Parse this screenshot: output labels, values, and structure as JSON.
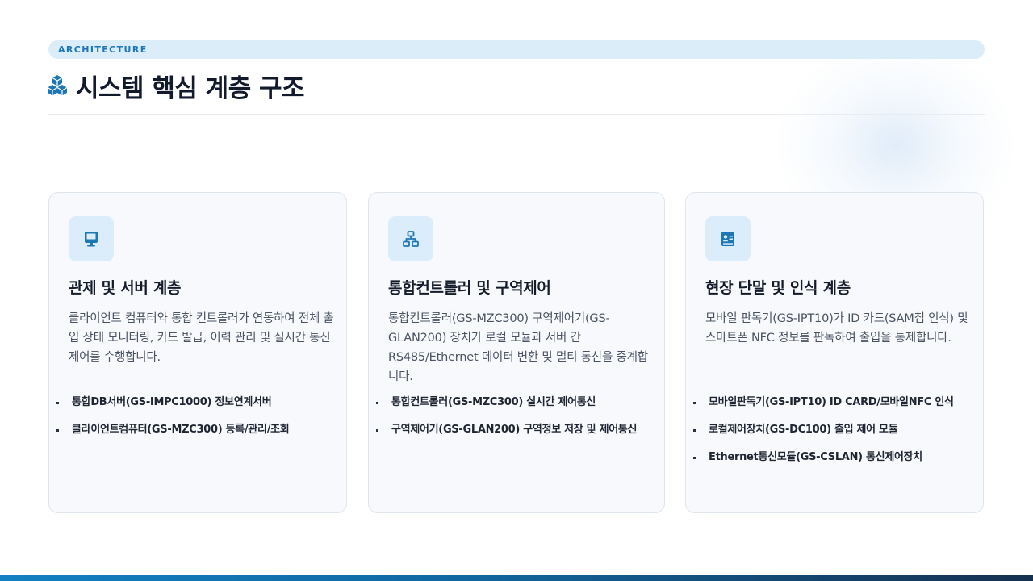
{
  "header": {
    "eyebrow": "ARCHITECTURE",
    "title": "시스템 핵심 계층 구조",
    "title_icon": "cubes-icon"
  },
  "colors": {
    "accent": "#1d77b4",
    "icon_bg": "#dbedfb",
    "card_bg": "#f7f9fc",
    "bottom_bar": [
      "#1280c2",
      "#16304f"
    ]
  },
  "cards": [
    {
      "icon": "desktop-icon",
      "title": "관제 및 서버 계층",
      "desc": "클라이언트 컴퓨터와 통합 컨트롤러가 연동하여 전체 출입 상태 모니터링, 카드 발급, 이력 관리 및 실시간 통신 제어를 수행합니다.",
      "bullets": [
        "통합DB서버(GS-IMPC1000) 정보연계서버",
        "클라이언트컴퓨터(GS-MZC300)  등록/관리/조회"
      ]
    },
    {
      "icon": "network-icon",
      "title": "통합컨트롤러 및 구역제어",
      "desc": "통합컨트롤러(GS-MZC300) 구역제어기(GS-GLAN200) 장치가 로컬 모듈과 서버 간 RS485/Ethernet 데이터 변환 및 멀티 통신을 중계합니다.",
      "bullets": [
        "통합컨트롤러(GS-MZC300) 실시간 제어통신",
        "구역제어기(GS-GLAN200) 구역정보 저장 및 제어통신"
      ]
    },
    {
      "icon": "id-card-icon",
      "title": "현장 단말 및 인식 계층",
      "desc": "모바일 판독기(GS-IPT10)가 ID 카드(SAM칩 인식) 및 스마트폰 NFC 정보를 판독하여 출입을 통제합니다.",
      "bullets": [
        "모바일판독기(GS-IPT10) ID CARD/모바일NFC 인식",
        "로컬제어장치(GS-DC100) 출입 제어 모듈",
        "Ethernet통신모듈(GS-CSLAN) 통신제어장치"
      ]
    }
  ]
}
